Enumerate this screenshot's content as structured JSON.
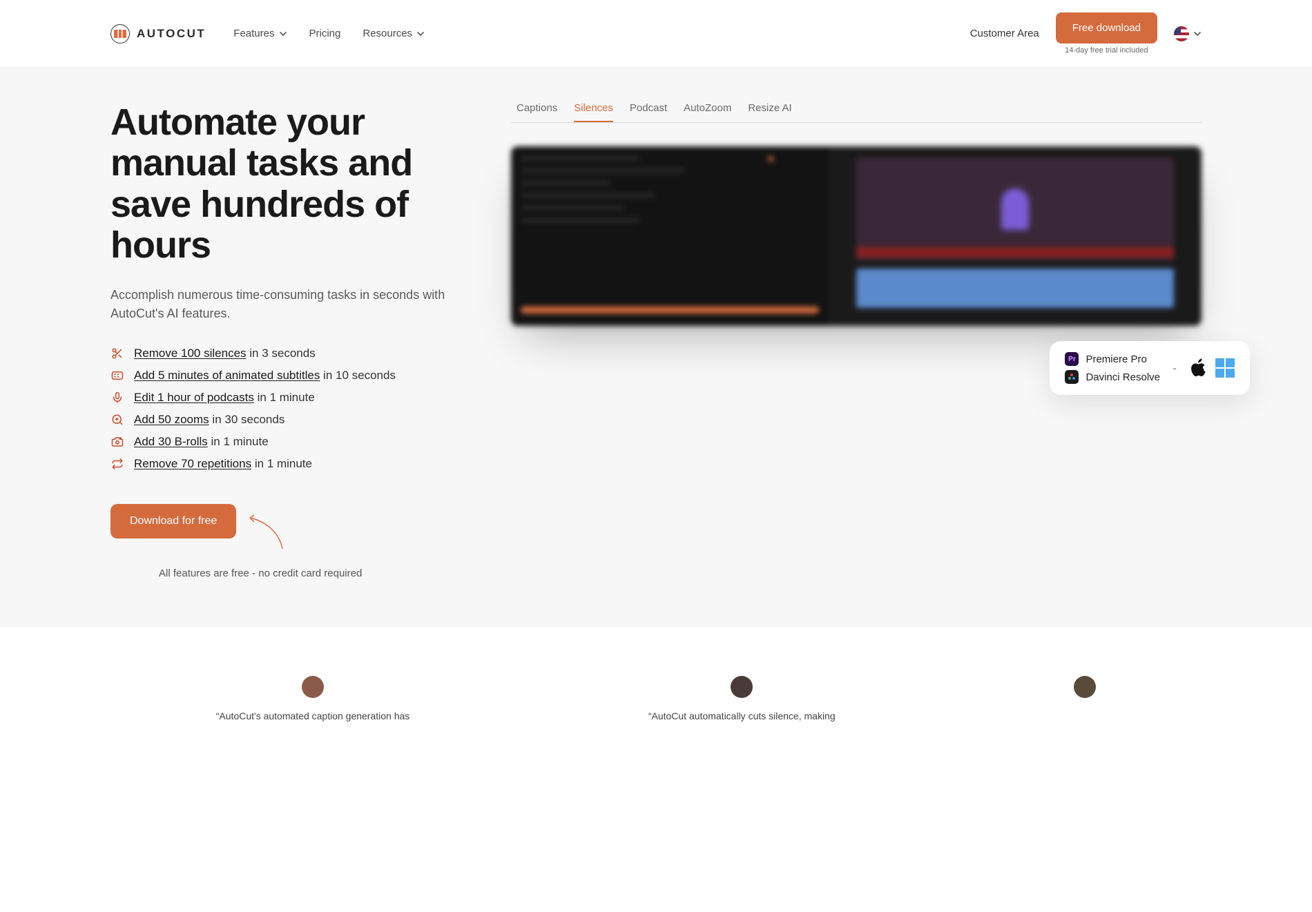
{
  "header": {
    "brand": "AUTOCUT",
    "nav": {
      "features": "Features",
      "pricing": "Pricing",
      "resources": "Resources"
    },
    "customer_area": "Customer Area",
    "download": "Free download",
    "trial_note": "14-day free trial included"
  },
  "hero": {
    "title": "Automate your manual tasks and save hundreds of hours",
    "subtitle": "Accomplish numerous time-consuming tasks in seconds with AutoCut's AI features.",
    "features": [
      {
        "link": "Remove 100 silences",
        "suffix": " in 3 seconds"
      },
      {
        "link": "Add 5 minutes of animated subtitles",
        "suffix": " in 10 seconds"
      },
      {
        "link": "Edit 1 hour of podcasts",
        "suffix": " in 1 minute"
      },
      {
        "link": "Add 50 zooms",
        "suffix": " in 30 seconds"
      },
      {
        "link": "Add 30 B-rolls",
        "suffix": " in 1 minute"
      },
      {
        "link": "Remove 70 repetitions",
        "suffix": " in 1 minute"
      }
    ],
    "cta": "Download for free",
    "cta_note": "All features are free - no credit card required",
    "tabs": [
      "Captions",
      "Silences",
      "Podcast",
      "AutoZoom",
      "Resize AI"
    ],
    "active_tab": 1,
    "platforms": {
      "premiere": "Premiere Pro",
      "davinci": "Davinci Resolve"
    }
  },
  "testimonials": [
    {
      "text": "“AutoCut's automated caption generation has"
    },
    {
      "text": "“AutoCut automatically cuts silence, making"
    },
    {
      "text": ""
    }
  ]
}
